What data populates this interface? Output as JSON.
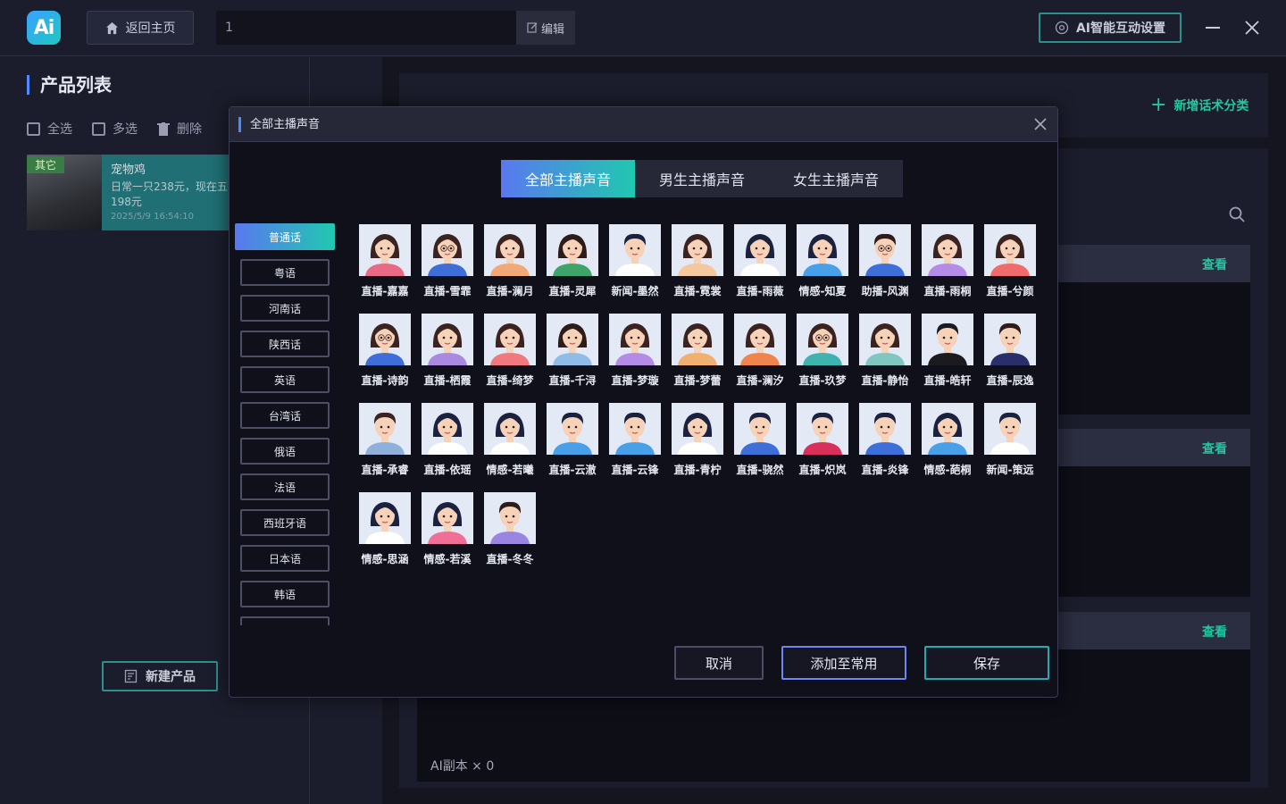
{
  "topbar": {
    "logo": "Ai",
    "home_label": "返回主页",
    "title_value": "1",
    "edit_label": "编辑",
    "ai_settings_label": "AI智能互动设置"
  },
  "left": {
    "title": "产品列表",
    "select_all": "全选",
    "multi_select": "多选",
    "delete": "删除",
    "product": {
      "tag": "其它",
      "name": "宠物鸡",
      "desc": "日常一只238元，现在五198元",
      "time": "2025/5/9 16:54:10"
    },
    "new_product": "新建产品"
  },
  "right": {
    "add_category": "新增话术分类",
    "view_label": "查看",
    "ai_copies": "AI副本 × 0"
  },
  "modal": {
    "title": "全部主播声音",
    "tabs": [
      "全部主播声音",
      "男生主播声音",
      "女生主播声音"
    ],
    "languages": [
      "普通话",
      "粤语",
      "河南话",
      "陕西话",
      "英语",
      "台湾话",
      "俄语",
      "法语",
      "西班牙语",
      "日本语",
      "韩语"
    ],
    "voices": [
      {
        "name": "直播-嘉嘉",
        "gender": "f",
        "shirt": "#e96a86",
        "hair": "#3a2320"
      },
      {
        "name": "直播-雪霏",
        "gender": "f",
        "shirt": "#3e6fd8",
        "hair": "#3a2320",
        "glasses": true
      },
      {
        "name": "直播-澜月",
        "gender": "f",
        "shirt": "#f2a877",
        "hair": "#3a2320"
      },
      {
        "name": "直播-灵犀",
        "gender": "f",
        "shirt": "#3fa46a",
        "hair": "#2d1c1a"
      },
      {
        "name": "新闻-墨然",
        "gender": "m",
        "shirt": "#ffffff",
        "hair": "#1b2240"
      },
      {
        "name": "直播-霓裳",
        "gender": "f",
        "shirt": "#f5c79e",
        "hair": "#3a2320"
      },
      {
        "name": "直播-雨薇",
        "gender": "f",
        "shirt": "#ffffff",
        "hair": "#1b2240"
      },
      {
        "name": "情感-知夏",
        "gender": "f",
        "shirt": "#47a0e8",
        "hair": "#1b2240"
      },
      {
        "name": "助播-风渊",
        "gender": "m",
        "shirt": "#3e6fd8",
        "hair": "#2d1c1a",
        "glasses": true
      },
      {
        "name": "直播-雨桐",
        "gender": "f",
        "shirt": "#b48ce8",
        "hair": "#3a2320"
      },
      {
        "name": "直播-兮颜",
        "gender": "f",
        "shirt": "#f06b6b",
        "hair": "#3a2320"
      },
      {
        "name": "直播-诗韵",
        "gender": "f",
        "shirt": "#3e6fd8",
        "hair": "#3a2320",
        "glasses": true
      },
      {
        "name": "直播-栖霞",
        "gender": "f",
        "shirt": "#a98ae0",
        "hair": "#3a2320"
      },
      {
        "name": "直播-绮梦",
        "gender": "f",
        "shirt": "#f0787e",
        "hair": "#3a2320"
      },
      {
        "name": "直播-千浔",
        "gender": "f",
        "shirt": "#8fbde8",
        "hair": "#2d1c1a"
      },
      {
        "name": "直播-梦璇",
        "gender": "f",
        "shirt": "#b48ce8",
        "hair": "#3a2320"
      },
      {
        "name": "直播-梦蕾",
        "gender": "f",
        "shirt": "#f2b070",
        "hair": "#3a2320"
      },
      {
        "name": "直播-澜汐",
        "gender": "f",
        "shirt": "#f0844e",
        "hair": "#3a2320"
      },
      {
        "name": "直播-玖梦",
        "gender": "f",
        "shirt": "#3fb3b0",
        "hair": "#3a2320",
        "glasses": true
      },
      {
        "name": "直播-静怡",
        "gender": "f",
        "shirt": "#7fc7c0",
        "hair": "#3a2320"
      },
      {
        "name": "直播-皓轩",
        "gender": "m",
        "shirt": "#1b1b1f",
        "hair": "#1b1b1f"
      },
      {
        "name": "直播-辰逸",
        "gender": "m",
        "shirt": "#2a2f6a",
        "hair": "#2d1c1a"
      },
      {
        "name": "直播-承睿",
        "gender": "m",
        "shirt": "#8fb0d8",
        "hair": "#3a2320"
      },
      {
        "name": "直播-依瑶",
        "gender": "f",
        "shirt": "#ffffff",
        "hair": "#1b2240"
      },
      {
        "name": "情感-若曦",
        "gender": "f",
        "shirt": "#ffffff",
        "hair": "#1b2240"
      },
      {
        "name": "直播-云澈",
        "gender": "m",
        "shirt": "#47a0e8",
        "hair": "#1b2240"
      },
      {
        "name": "直播-云锋",
        "gender": "m",
        "shirt": "#47a0e8",
        "hair": "#1b2240"
      },
      {
        "name": "直播-青柠",
        "gender": "f",
        "shirt": "#ffffff",
        "hair": "#1b2240"
      },
      {
        "name": "直播-骁然",
        "gender": "m",
        "shirt": "#3e6fd8",
        "hair": "#1b2240"
      },
      {
        "name": "直播-炽岚",
        "gender": "m",
        "shirt": "#d8305a",
        "hair": "#1b2240"
      },
      {
        "name": "直播-炎锋",
        "gender": "m",
        "shirt": "#3e6fd8",
        "hair": "#1b2240"
      },
      {
        "name": "情感-葩桐",
        "gender": "f",
        "shirt": "#47a0e8",
        "hair": "#1b2240"
      },
      {
        "name": "新闻-策远",
        "gender": "m",
        "shirt": "#ffffff",
        "hair": "#1b2240"
      },
      {
        "name": "情感-思涵",
        "gender": "f",
        "shirt": "#ffffff",
        "hair": "#1b2240"
      },
      {
        "name": "情感-若溪",
        "gender": "f",
        "shirt": "#ef6f96",
        "hair": "#1b2240"
      },
      {
        "name": "直播-冬冬",
        "gender": "m",
        "shirt": "#9a86e0",
        "hair": "#2d1c1a"
      }
    ],
    "cancel": "取消",
    "add_common": "添加至常用",
    "save": "保存"
  },
  "colors": {
    "accent_teal": "#1ec8a0",
    "accent_blue": "#4a8cff",
    "modal_bg": "#0f101a"
  }
}
